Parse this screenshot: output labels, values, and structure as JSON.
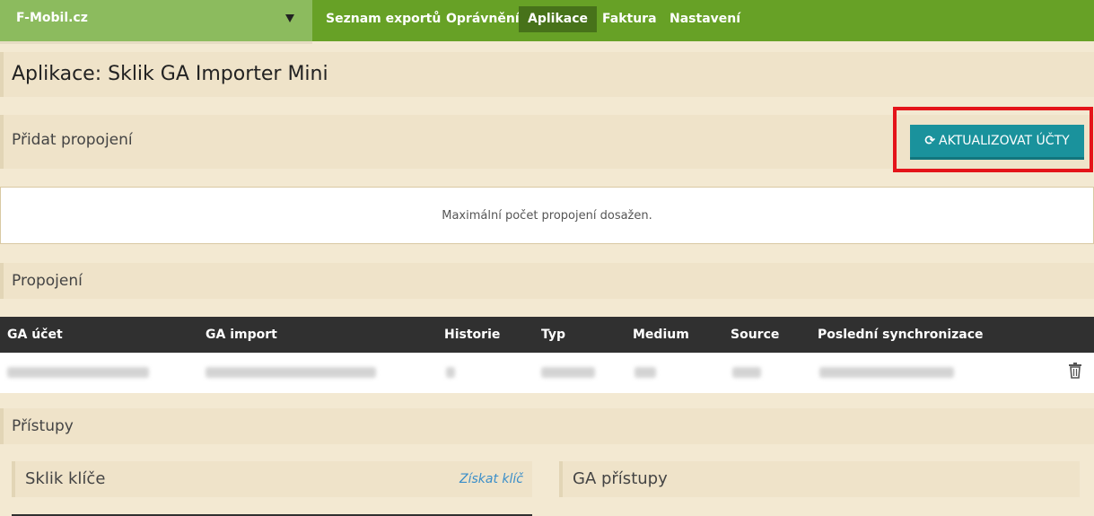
{
  "topbar": {
    "brand": "F-Mobil.cz",
    "nav": [
      "Seznam exportů",
      "Oprávnění",
      "Aplikace",
      "Faktura",
      "Nastavení"
    ],
    "active_nav": "Aplikace",
    "colors": {
      "bar": "#67a126",
      "brand_bg": "#8cbb5e",
      "active": "#47721a"
    }
  },
  "page": {
    "title": "Aplikace: Sklik GA Importer Mini"
  },
  "add_connection": {
    "title": "Přidat propojení",
    "update_button": "AKTUALIZOVAT ÚČTY",
    "update_icon": "refresh-icon",
    "message": "Maximální počet propojení dosažen."
  },
  "connections": {
    "title": "Propojení",
    "columns": [
      "GA účet",
      "GA import",
      "Historie",
      "Typ",
      "Medium",
      "Source",
      "Poslední synchronizace"
    ],
    "rows": [
      {
        "cells": [
          "",
          "",
          "",
          "",
          "",
          "",
          ""
        ],
        "note_redacted": true
      }
    ],
    "row_action_icon": "trash-icon"
  },
  "access": {
    "title": "Přístupy",
    "sklik": {
      "title": "Sklik klíče",
      "link": "Získat klíč"
    },
    "ga": {
      "title": "GA přístupy"
    }
  }
}
